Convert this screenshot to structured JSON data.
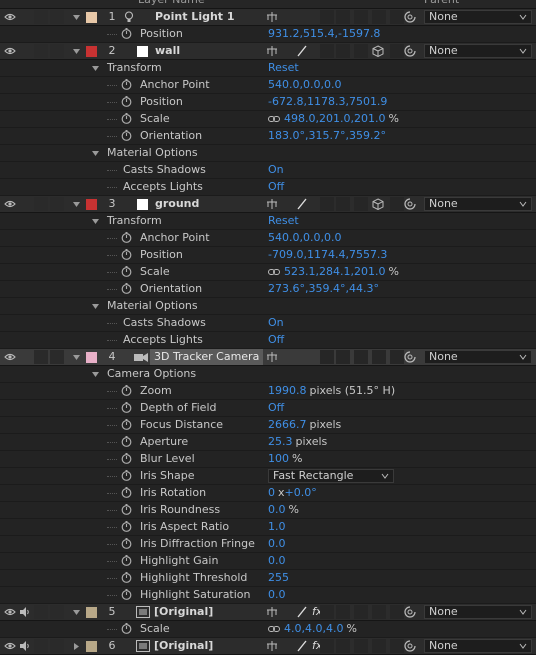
{
  "header": {
    "col_layer_name": "Layer Name",
    "col_parent": "Parent"
  },
  "layers": [
    {
      "num": "1",
      "name": "Point Light 1",
      "color": "#e8c8a8",
      "parent": "None",
      "props": [
        {
          "name": "Position",
          "value": "931.2,515.4,-1597.8"
        }
      ]
    },
    {
      "num": "2",
      "name": "wall",
      "color": "#c83232",
      "parent": "None",
      "transform": {
        "label": "Transform",
        "reset": "Reset",
        "props": [
          {
            "name": "Anchor Point",
            "value": "540.0,0.0,0.0"
          },
          {
            "name": "Position",
            "value": "-672.8,1178.3,7501.9"
          },
          {
            "name": "Scale",
            "value": "498.0,201.0,201.0",
            "unit": "%"
          },
          {
            "name": "Orientation",
            "value": "183.0°,315.7°,359.2°"
          }
        ]
      },
      "material": {
        "label": "Material Options",
        "props": [
          {
            "name": "Casts Shadows",
            "value": "On"
          },
          {
            "name": "Accepts Lights",
            "value": "Off"
          }
        ]
      }
    },
    {
      "num": "3",
      "name": "ground",
      "color": "#c83232",
      "parent": "None",
      "transform": {
        "label": "Transform",
        "reset": "Reset",
        "props": [
          {
            "name": "Anchor Point",
            "value": "540.0,0.0,0.0"
          },
          {
            "name": "Position",
            "value": "-709.0,1174.4,7557.3"
          },
          {
            "name": "Scale",
            "value": "523.1,284.1,201.0",
            "unit": "%"
          },
          {
            "name": "Orientation",
            "value": "273.6°,359.4°,44.3°"
          }
        ]
      },
      "material": {
        "label": "Material Options",
        "props": [
          {
            "name": "Casts Shadows",
            "value": "On"
          },
          {
            "name": "Accepts Lights",
            "value": "Off"
          }
        ]
      }
    },
    {
      "num": "4",
      "name": "3D Tracker Camera",
      "color": "#e8b0c8",
      "parent": "None",
      "camera": {
        "label": "Camera Options",
        "props": [
          {
            "name": "Zoom",
            "value": "1990.8",
            "unit": "pixels (51.5° H)"
          },
          {
            "name": "Depth of Field",
            "value": "Off"
          },
          {
            "name": "Focus Distance",
            "value": "2666.7",
            "unit": "pixels"
          },
          {
            "name": "Aperture",
            "value": "25.3",
            "unit": "pixels"
          },
          {
            "name": "Blur Level",
            "value": "100",
            "unit": "%"
          },
          {
            "name": "Iris Shape",
            "dropdown": "Fast Rectangle"
          },
          {
            "name": "Iris Rotation",
            "value": "0",
            "unit": "x",
            "value2": "+0.0°"
          },
          {
            "name": "Iris Roundness",
            "value": "0.0",
            "unit": "%"
          },
          {
            "name": "Iris Aspect Ratio",
            "value": "1.0"
          },
          {
            "name": "Iris Diffraction Fringe",
            "value": "0.0"
          },
          {
            "name": "Highlight Gain",
            "value": "0.0"
          },
          {
            "name": "Highlight Threshold",
            "value": "255"
          },
          {
            "name": "Highlight Saturation",
            "value": "0.0"
          }
        ]
      }
    },
    {
      "num": "5",
      "name": "[Original]",
      "color": "#b8a888",
      "parent": "None",
      "props": [
        {
          "name": "Scale",
          "value": "4.0,4.0,4.0",
          "unit": "%"
        }
      ]
    },
    {
      "num": "6",
      "name": "[Original]",
      "color": "#b8a888",
      "parent": "None"
    }
  ],
  "colors": {
    "value_blue": "#3f8fe6",
    "bg": "#232323",
    "layer_bg": "#2c2c2c"
  }
}
